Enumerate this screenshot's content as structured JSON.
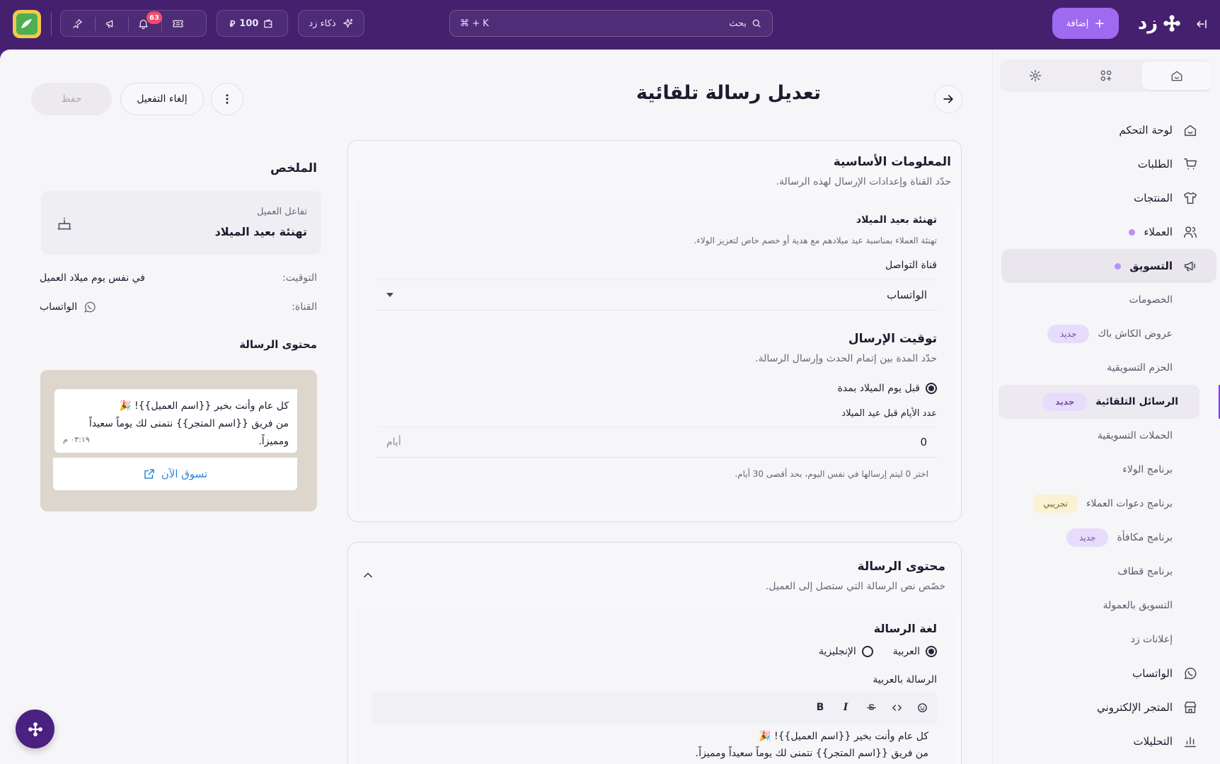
{
  "topbar": {
    "notifications_count": "63",
    "credits": "100",
    "ai_label": "ذكاء زد",
    "search_placeholder": "بحث",
    "search_shortcut": "⌘ + K",
    "add_label": "إضافة",
    "brand_name": "زد"
  },
  "sidebar": {
    "nav": [
      {
        "label": "لوحة التحكم",
        "icon": "home-icon"
      },
      {
        "label": "الطلبات",
        "icon": "cart-icon"
      },
      {
        "label": "المنتجات",
        "icon": "shirt-icon"
      },
      {
        "label": "العملاء",
        "icon": "users-icon"
      },
      {
        "label": "التسويق",
        "icon": "megaphone-icon"
      }
    ],
    "marketing_sub": [
      {
        "label": "الخصومات"
      },
      {
        "label": "عروض الكاش باك",
        "badge": "جديد"
      },
      {
        "label": "الحزم التسويقية"
      },
      {
        "label": "الرسائل التلقائية",
        "badge": "جديد"
      },
      {
        "label": "الحملات التسويقية"
      },
      {
        "label": "برنامج الولاء"
      },
      {
        "label": "برنامج دعوات العملاء",
        "badge": "تجريبي"
      },
      {
        "label": "برنامج مكافأة",
        "badge": "جديد"
      },
      {
        "label": "برنامج قطاف"
      },
      {
        "label": "التسويق بالعمولة"
      },
      {
        "label": "إعلانات زد"
      }
    ],
    "bottom_nav": [
      {
        "label": "الواتساب",
        "icon": "whatsapp-icon"
      },
      {
        "label": "المتجر الإلكتروني",
        "icon": "store-icon"
      },
      {
        "label": "التحليلات",
        "icon": "chart-icon"
      }
    ]
  },
  "header": {
    "title": "تعديل رسالة تلقائية",
    "deactivate_label": "إلغاء التفعيل",
    "save_label": "حفظ"
  },
  "summary": {
    "title": "الملخص",
    "type_label": "تفاعل العميل",
    "type_value": "تهنئة بعيد الميلاد",
    "timing_label": "التوقيت:",
    "timing_value": "في نفس يوم ميلاد العميل",
    "channel_label": "القناة:",
    "channel_value": "الواتساب",
    "content_title": "محتوى الرسالة",
    "preview_line1": "كل عام وأنت بخير {{اسم العميل}}! 🎉",
    "preview_line2": "من فريق {{اسم المتجر}} نتمنى لك يوماً سعيداً ومميزاً.",
    "preview_time": "٠٣:١٩ م",
    "cta_label": "تسوق الآن"
  },
  "basic_info": {
    "title": "المعلومات الأساسية",
    "desc": "حدّد القناة وإعدادات الإرسال لهذه الرسالة.",
    "msg_name": "تهنئة بعيد الميلاد",
    "msg_desc": "تهنئة العملاء بمناسبة عيد ميلادهم مع هدية أو خصم خاص لتعزيز الولاء.",
    "channel_label": "قناة التواصل",
    "channel_value": "الواتساب",
    "timing_title": "توقيت الإرسال",
    "timing_desc": "حدّد المدة بين إتمام الحدث وإرسال الرسالة.",
    "timing_option": "قبل يوم الميلاد بمدة",
    "days_label": "عدد الأيام قبل عيد الميلاد",
    "days_value": "0",
    "days_unit": "أيام",
    "days_hint": "اختر 0 ليتم إرسالها في نفس اليوم، بحد أقصى 30 أيام."
  },
  "message_content": {
    "title": "محتوى الرسالة",
    "desc": "خصّص نص الرسالة التي ستصل إلى العميل.",
    "lang_label": "لغة الرسالة",
    "lang_ar": "العربية",
    "lang_en": "الإنجليزية",
    "ar_label": "الرسالة بالعربية",
    "editor_line1": "كل عام وأنت بخير {{اسم العميل}}! 🎉",
    "editor_line2": "من فريق {{اسم المتجر}} نتمنى لك يوماً سعيداً ومميزاً."
  }
}
